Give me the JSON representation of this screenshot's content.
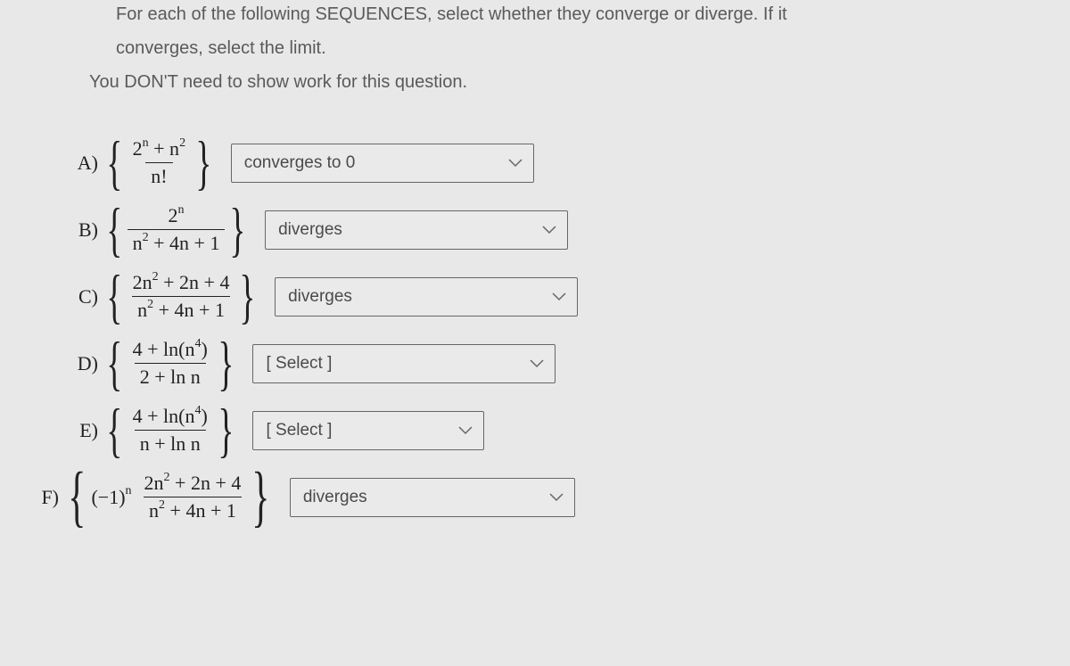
{
  "instructions": {
    "line1": "For each of the following SEQUENCES, select whether they converge or diverge. If it",
    "line2": "converges, select the limit.",
    "line3": "You DON'T need to show work for this question."
  },
  "labels": {
    "A": "A)",
    "B": "B)",
    "C": "C)",
    "D": "D)",
    "E": "E)",
    "F": "F)"
  },
  "formulas": {
    "A_num": "2ⁿ + n²",
    "A_den": "n!",
    "B_num": "2ⁿ",
    "B_den": "n² + 4n + 1",
    "C_num": "2n² + 2n + 4",
    "C_den": "n² + 4n + 1",
    "D_num": "4 + ln(n⁴)",
    "D_den": "2 + ln n",
    "E_num": "4 + ln(n⁴)",
    "E_den": "n + ln n",
    "F_prefix": "(−1)ⁿ",
    "F_num": "2n² + 2n + 4",
    "F_den": "n² + 4n + 1"
  },
  "selects": {
    "A": "converges to 0",
    "B": "diverges",
    "C": "diverges",
    "D": "[ Select ]",
    "E": "[ Select ]",
    "F": "diverges"
  }
}
